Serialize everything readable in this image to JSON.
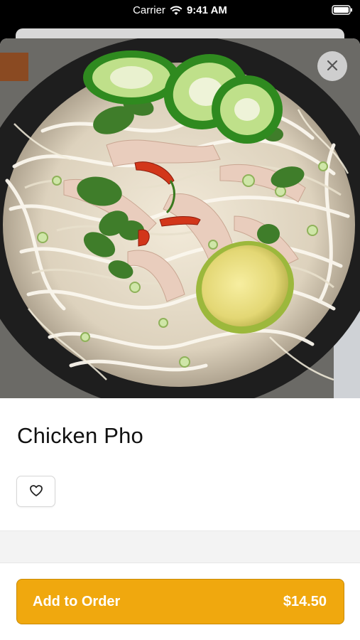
{
  "status_bar": {
    "carrier": "Carrier",
    "time": "9:41 AM",
    "wifi_icon": "wifi-icon",
    "battery_icon": "battery-icon"
  },
  "item": {
    "image_alt": "chicken-pho-photo",
    "title": "Chicken Pho",
    "favorite_icon": "heart-outline-icon"
  },
  "close_icon": "close-icon",
  "footer": {
    "add_label": "Add to Order",
    "price": "$14.50"
  },
  "colors": {
    "accent": "#f0a80e",
    "accent_border": "#c98a05",
    "close_bg": "#d7d7d7"
  }
}
